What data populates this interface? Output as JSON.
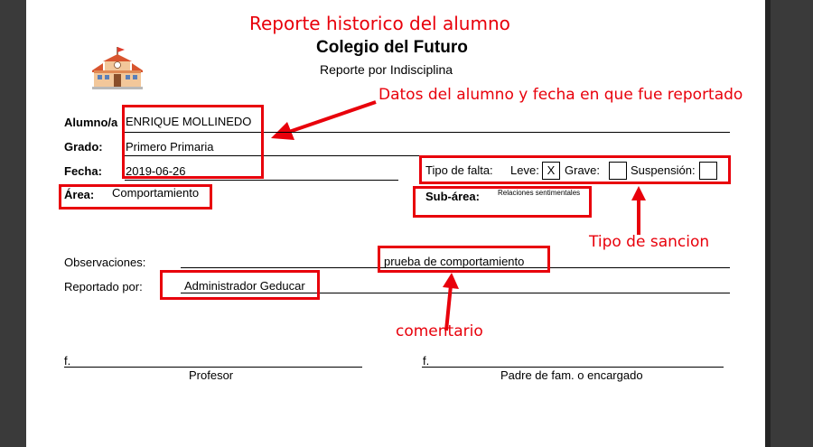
{
  "annotations": {
    "title": "Reporte historico del alumno",
    "student_data": "Datos del alumno y fecha en que fue reportado",
    "sanction_type": "Tipo de sancion",
    "comment": "comentario"
  },
  "header": {
    "school_name": "Colegio del Futuro",
    "report_type": "Reporte por Indisciplina"
  },
  "student": {
    "name_label": "Alumno/a",
    "name_value": "ENRIQUE MOLLINEDO",
    "grade_label": "Grado:",
    "grade_value": "Primero Primaria",
    "date_label": "Fecha:",
    "date_value": "2019-06-26",
    "area_label": "Área:",
    "area_value": "Comportamiento",
    "subarea_label": "Sub-área:",
    "subarea_value": "Relaciones sentimentales"
  },
  "fault": {
    "label": "Tipo de falta:",
    "leve_label": "Leve:",
    "leve_mark": "X",
    "grave_label": "Grave:",
    "grave_mark": "",
    "suspension_label": "Suspensión:",
    "suspension_mark": ""
  },
  "report": {
    "observations_label": "Observaciones:",
    "observations_value": "prueba de comportamiento",
    "reported_by_label": "Reportado por:",
    "reported_by_value": "Administrador Geducar"
  },
  "signatures": {
    "f_left": "f.",
    "professor": "Profesor",
    "f_right": "f.",
    "parent": "Padre de fam. o encargado"
  },
  "colors": {
    "annotation": "#e8000b",
    "viewer_background": "#3a3a3a"
  },
  "icons": {
    "logo": "school-building-icon"
  }
}
